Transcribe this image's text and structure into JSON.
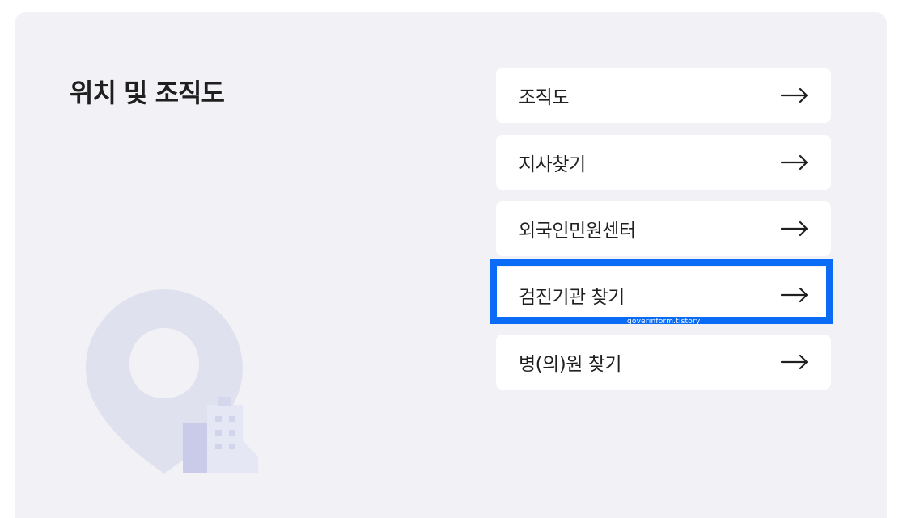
{
  "section": {
    "title": "위치 및 조직도"
  },
  "menu": {
    "items": [
      {
        "label": "조직도"
      },
      {
        "label": "지사찾기"
      },
      {
        "label": "외국인민원센터"
      },
      {
        "label": "검진기관 찾기"
      },
      {
        "label": "병(의)원 찾기"
      }
    ],
    "highlighted_index": 3
  },
  "watermark": {
    "text": "goverinform.tistory"
  },
  "colors": {
    "panel_background": "#f2f2f6",
    "item_background": "#ffffff",
    "highlight_border": "#0a6cf5",
    "text": "#1f1f1f",
    "pin": "#dfe1ee",
    "building_dark": "#c9cbe8",
    "building_light": "#e6e7f4"
  },
  "icons": {
    "arrow": "arrow-right-icon",
    "illustration": "location-pin-building-icon"
  }
}
